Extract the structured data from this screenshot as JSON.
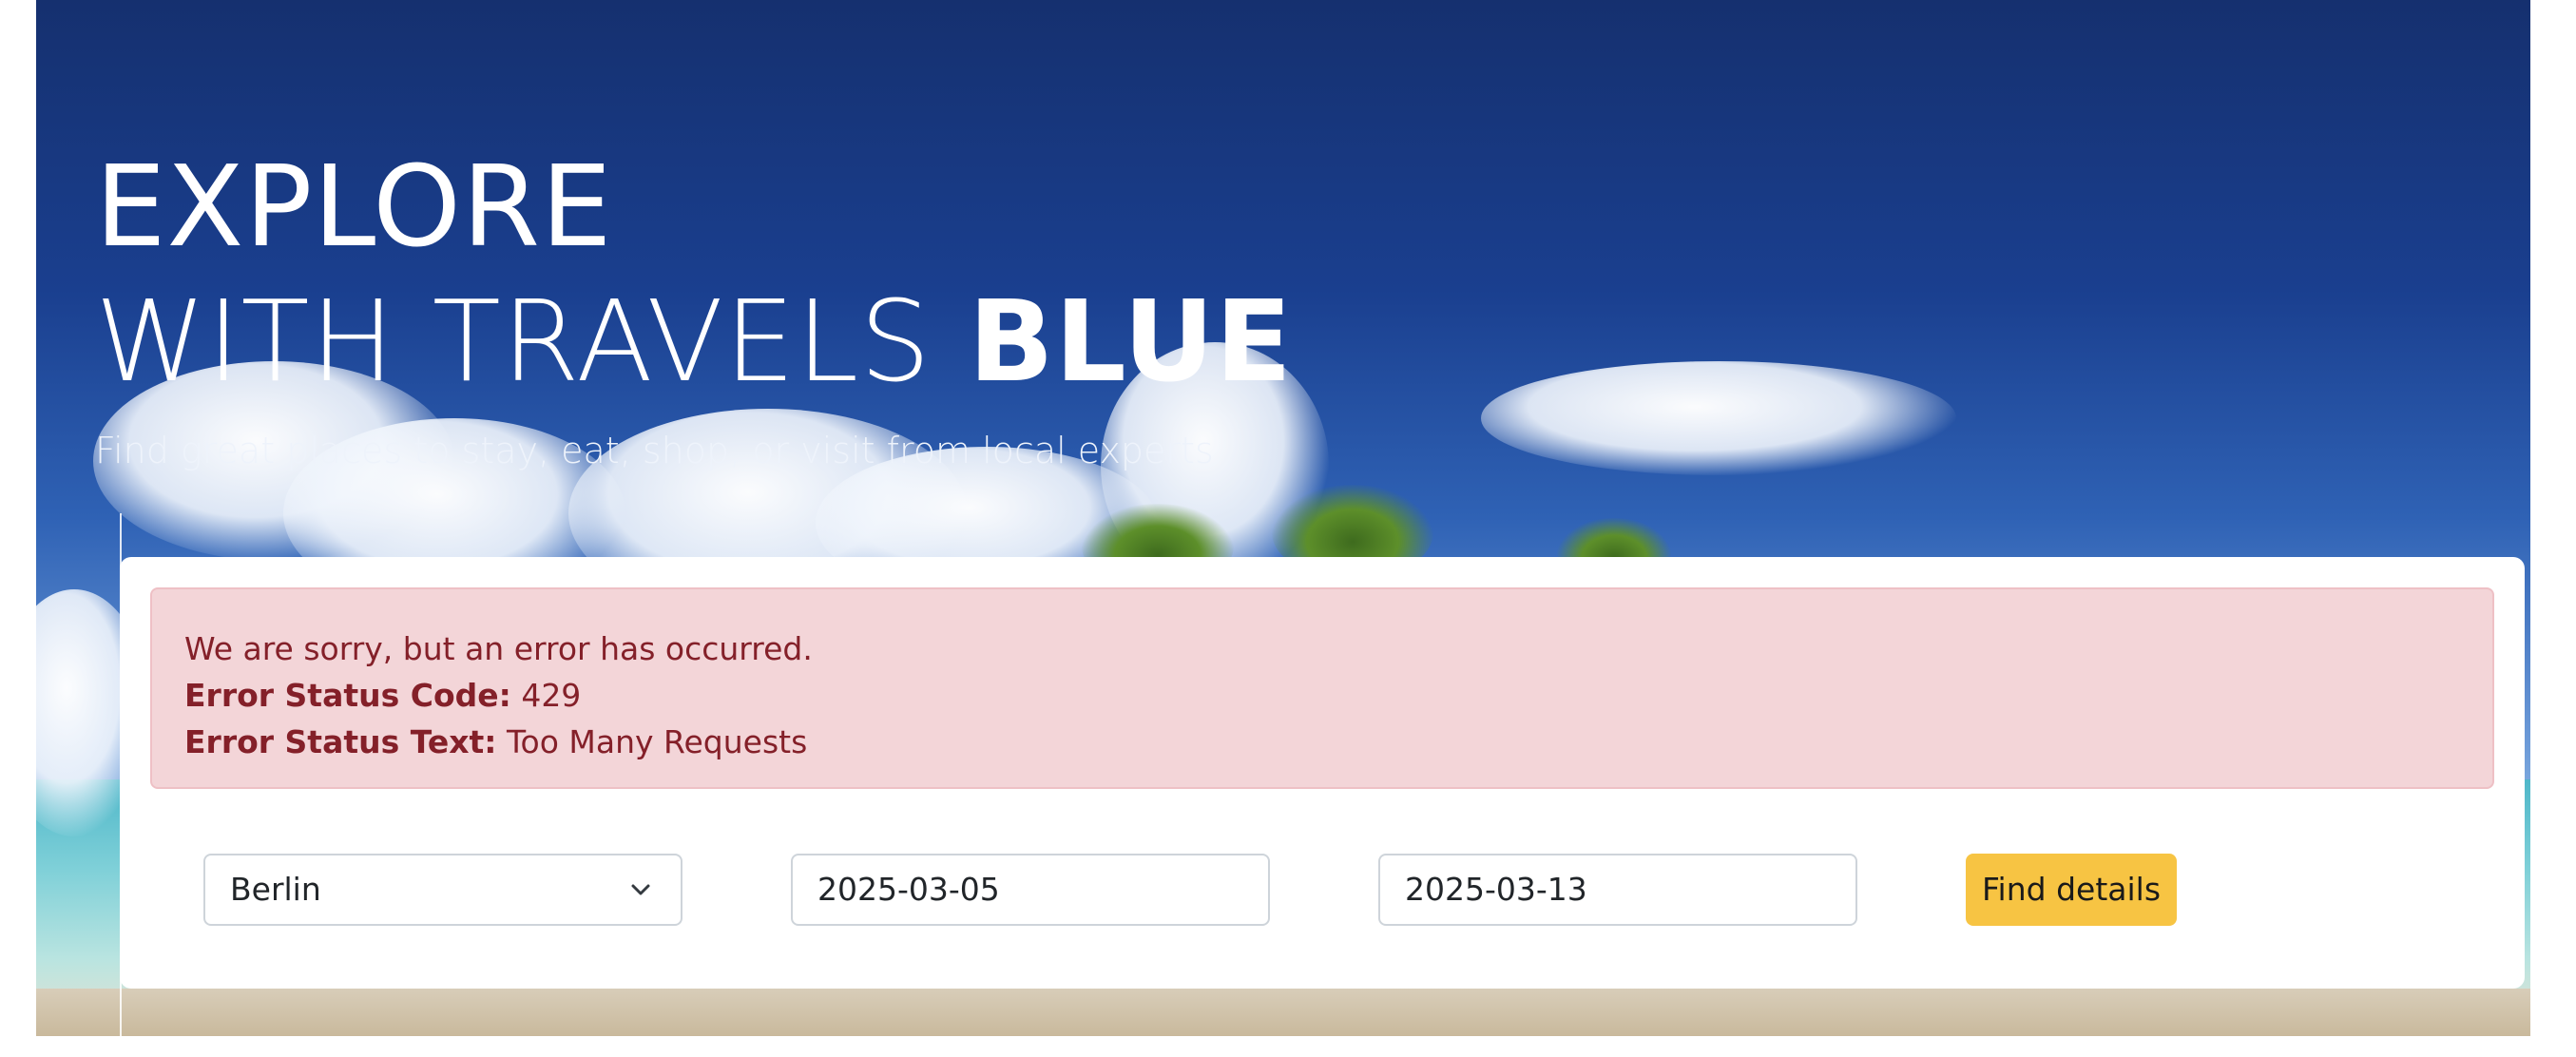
{
  "hero": {
    "title_line1": "EXPLORE",
    "title_line2_light": "WITH TRAVELS ",
    "title_line2_bold": "BLUE",
    "subtitle": "Find great places to stay, eat, shop, or visit from local experts"
  },
  "error_alert": {
    "message": "We are sorry, but an error has occurred.",
    "status_code_label": "Error Status Code:",
    "status_code_value": " 429",
    "status_text_label": "Error Status Text:",
    "status_text_value": " Too Many Requests"
  },
  "search_form": {
    "city_select_value": "Berlin",
    "start_date_value": "2025-03-05",
    "end_date_value": "2025-03-13",
    "submit_label": "Find details"
  },
  "colors": {
    "button": "#f7c443",
    "alert_bg": "#f3d5d8",
    "alert_text": "#842029"
  },
  "icons": {
    "select_chevron": "chevron-down-icon"
  }
}
